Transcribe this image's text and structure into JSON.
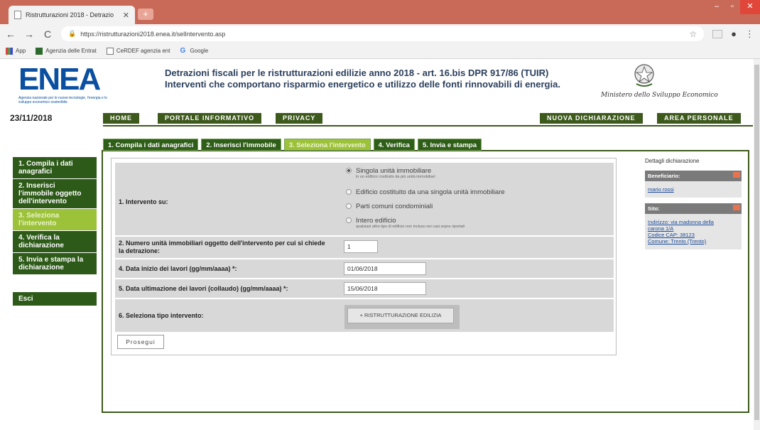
{
  "browser": {
    "tab_title": "Ristrutturazioni 2018 - Detrazio",
    "new_tab": "+",
    "url": "https://ristrutturazioni2018.enea.it/selIntervento.asp",
    "back": "←",
    "forward": "→",
    "reload": "C",
    "bookmarks": [
      {
        "label": "App",
        "icon": "apps-icon"
      },
      {
        "label": "Agenzia delle Entrat",
        "icon": "ade-icon"
      },
      {
        "label": "CeRDEF agenzia ent",
        "icon": "doc-icon"
      },
      {
        "label": "Google",
        "icon": "g-icon"
      }
    ]
  },
  "header": {
    "logo": "ENEA",
    "logo_sub": "Agenzia nazionale per le nuove tecnologie, l'energia e lo sviluppo economico sostenibile",
    "title_line1": "Detrazioni fiscali per le ristrutturazioni edilizie anno 2018 - art. 16.bis DPR 917/86 (TUIR)",
    "title_line2": "Interventi che comportano risparmio energetico e utilizzo delle fonti rinnovabili di energia.",
    "ministry": "Ministero dello Sviluppo Economico"
  },
  "nav": {
    "date": "23/11/2018",
    "items": [
      "Home",
      "Portale Informativo",
      "Privacy",
      "Nuova dichiarazione",
      "Area personale"
    ]
  },
  "steps": [
    "1. Compila i dati anagrafici",
    "2. Inserisci l'immobile",
    "3. Seleziona l'intervento",
    "4. Verifica",
    "5. Invia e stampa"
  ],
  "sidemenu": [
    "1. Compila i dati anagrafici",
    "2. Inserisci l'immobile oggetto dell'intervento",
    "3. Seleziona l'intervento",
    "4. Verifica la dichiarazione",
    "5. Invia e stampa la dichiarazione",
    "Esci"
  ],
  "form": {
    "q1_label": "1. Intervento su:",
    "q1_options": [
      {
        "label": "Singola unità immobiliare",
        "sub": "in un edificio costituito da più unità immobiliari",
        "selected": true
      },
      {
        "label": "Edificio costituito da una singola unità immobiliare",
        "sub": "",
        "selected": false
      },
      {
        "label": "Parti comuni condominiali",
        "sub": "",
        "selected": false
      },
      {
        "label": "Intero edificio",
        "sub": "qualsiasi altro tipo di edificio non incluso nei casi sopra riportati",
        "selected": false
      }
    ],
    "q2_label": "2. Numero unità immobiliari oggetto dell'intervento per cui si chiede la detrazione:",
    "q2_value": "1",
    "q3_label": "4. Data inizio dei lavori (gg/mm/aaaa) *:",
    "q3_value": "01/06/2018",
    "q4_label": "5. Data ultimazione dei lavori (collaudo) (gg/mm/aaaa) *:",
    "q4_value": "15/06/2018",
    "q5_label": "6. Seleziona tipo intervento:",
    "q5_value": "+ RISTRUTTURAZIONE EDILIZIA",
    "submit": "Prosegui"
  },
  "details": {
    "title": "Dettagli dichiarazione",
    "beneficiario_head": "Beneficiario:",
    "beneficiario": "mario rossi",
    "sito_head": "Sito:",
    "sito_lines": [
      "Indirizzo: via madonna della",
      "carona 1/A",
      "Codice CAP: 38123",
      "Comune: Trento (Trento)"
    ]
  }
}
